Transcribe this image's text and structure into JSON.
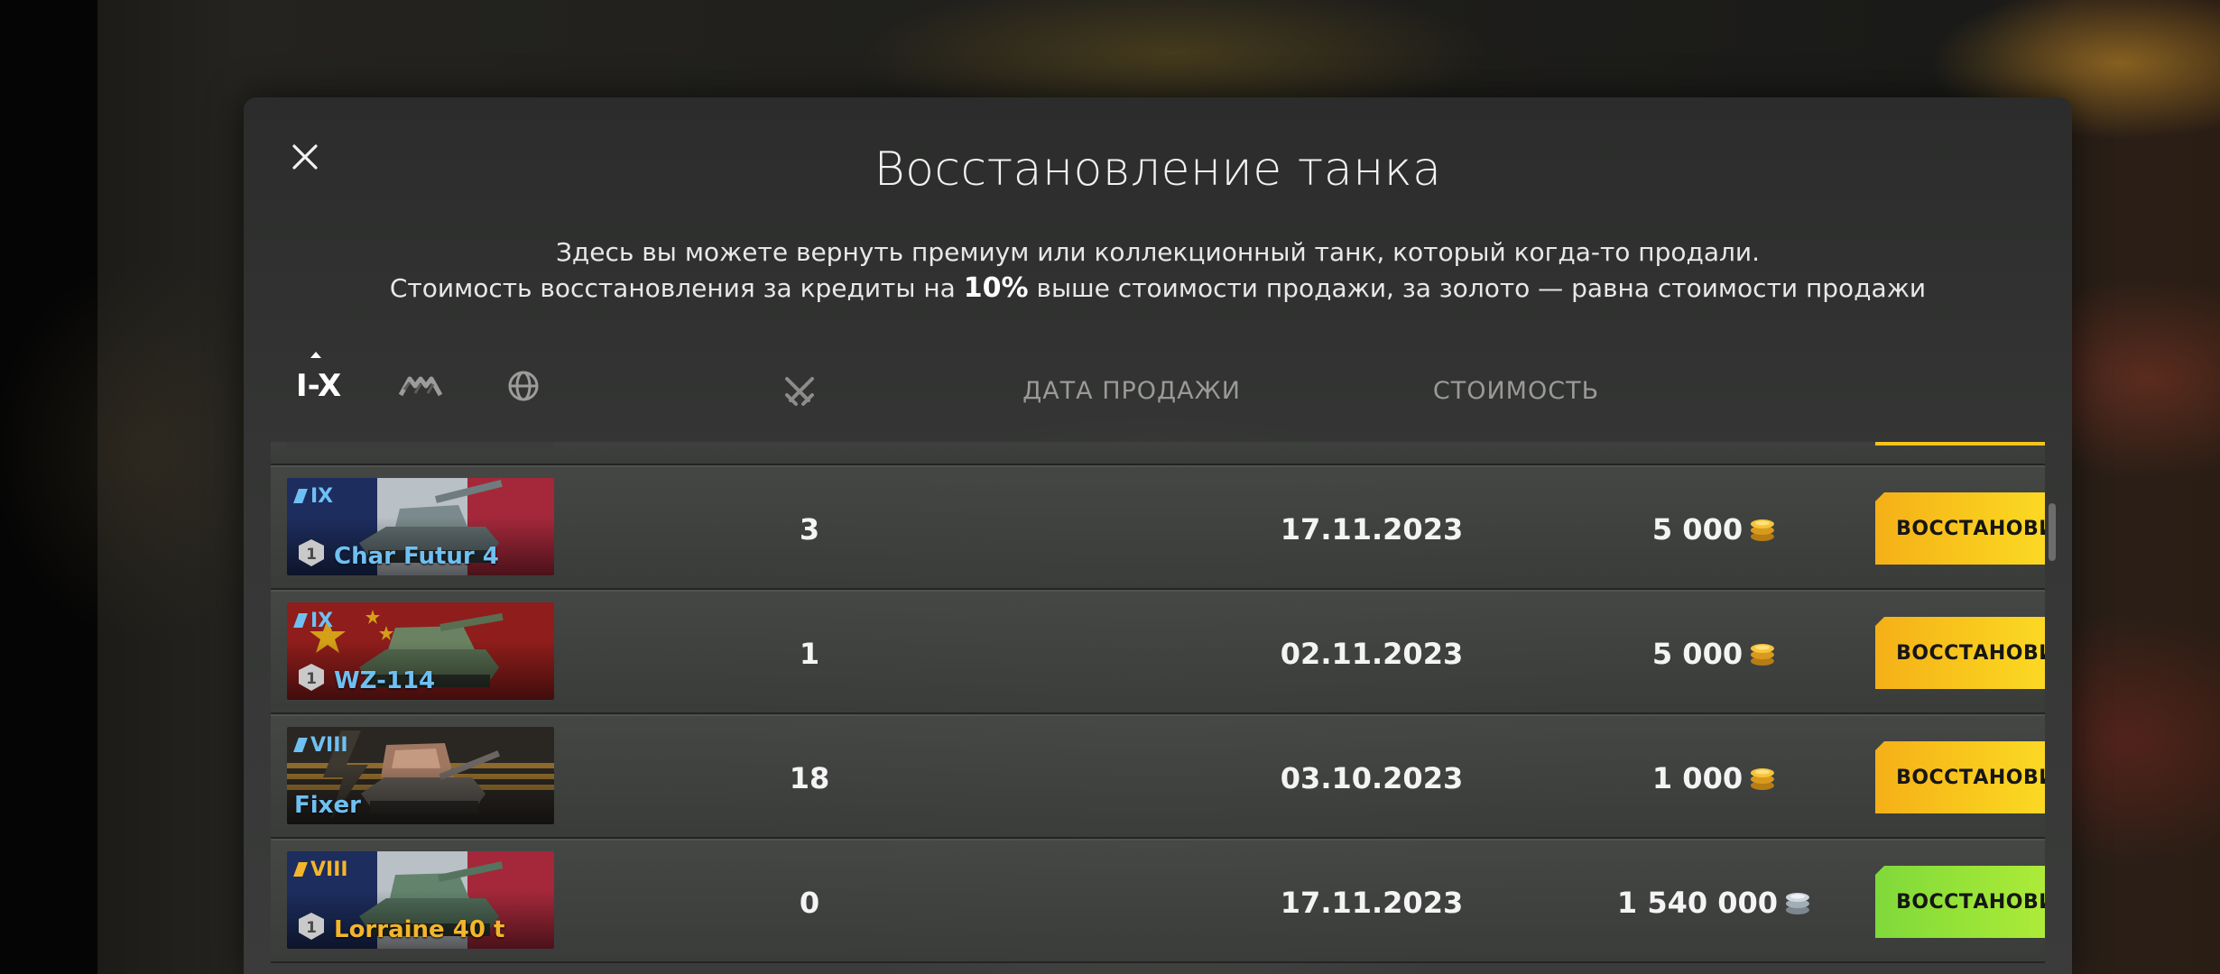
{
  "modal": {
    "title": "Восстановление танка",
    "desc_line1": "Здесь вы можете вернуть премиум или коллекционный танк, который когда-то продали.",
    "desc_line2_pre": "Стоимость восстановления за кредиты на ",
    "desc_line2_bold": "10%",
    "desc_line2_post": " выше стоимости продажи, за золото — равна стоимости продажи"
  },
  "filters": {
    "tier_label": "I-X",
    "type_icon": "vehicle-type-icon",
    "nation_icon": "globe-icon"
  },
  "columns": {
    "battles_icon": "crossed-swords-icon",
    "date": "ДАТА ПРОДАЖИ",
    "cost": "СТОИМОСТЬ"
  },
  "rows": [
    {
      "tier": "IX",
      "name": "Char Futur 4",
      "name_color": "#6fc0f2",
      "flag": "france",
      "mastery": "1",
      "battles": "3",
      "date": "17.11.2023",
      "cost": "5 000",
      "currency": "gold",
      "button": "ВОССТАНОВИТЬ"
    },
    {
      "tier": "IX",
      "name": "WZ-114",
      "name_color": "#6fc0f2",
      "flag": "china",
      "mastery": "1",
      "battles": "1",
      "date": "02.11.2023",
      "cost": "5 000",
      "currency": "gold",
      "button": "ВОССТАНОВИТЬ"
    },
    {
      "tier": "VIII",
      "name": "Fixer",
      "name_color": "#6fc0f2",
      "flag": "collector",
      "mastery": "",
      "battles": "18",
      "date": "03.10.2023",
      "cost": "1 000",
      "currency": "gold",
      "button": "ВОССТАНОВИТЬ"
    },
    {
      "tier": "VIII",
      "name": "Lorraine 40 t",
      "name_color": "#f3b52b",
      "flag": "france",
      "mastery": "1",
      "battles": "0",
      "date": "17.11.2023",
      "cost": "1 540 000",
      "currency": "credits",
      "button": "ВОССТАНОВИТЬ"
    }
  ]
}
